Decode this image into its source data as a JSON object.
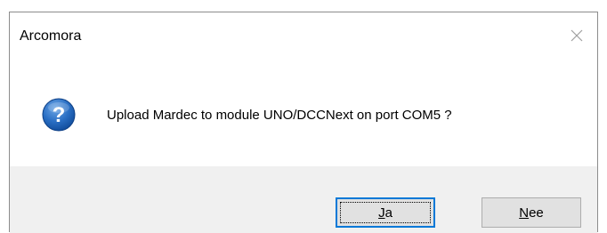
{
  "window": {
    "title": "Arcomora"
  },
  "message": {
    "text": "Upload Mardec to module UNO/DCCNext on port COM5 ?",
    "icon": "question-icon"
  },
  "buttons": {
    "yes": {
      "mnemonic": "J",
      "rest": "a"
    },
    "no": {
      "mnemonic": "N",
      "rest": "ee"
    }
  },
  "colors": {
    "icon_blue": "#1c63b7",
    "default_button_border": "#0078d7",
    "footer_bg": "#f0f0f0"
  }
}
